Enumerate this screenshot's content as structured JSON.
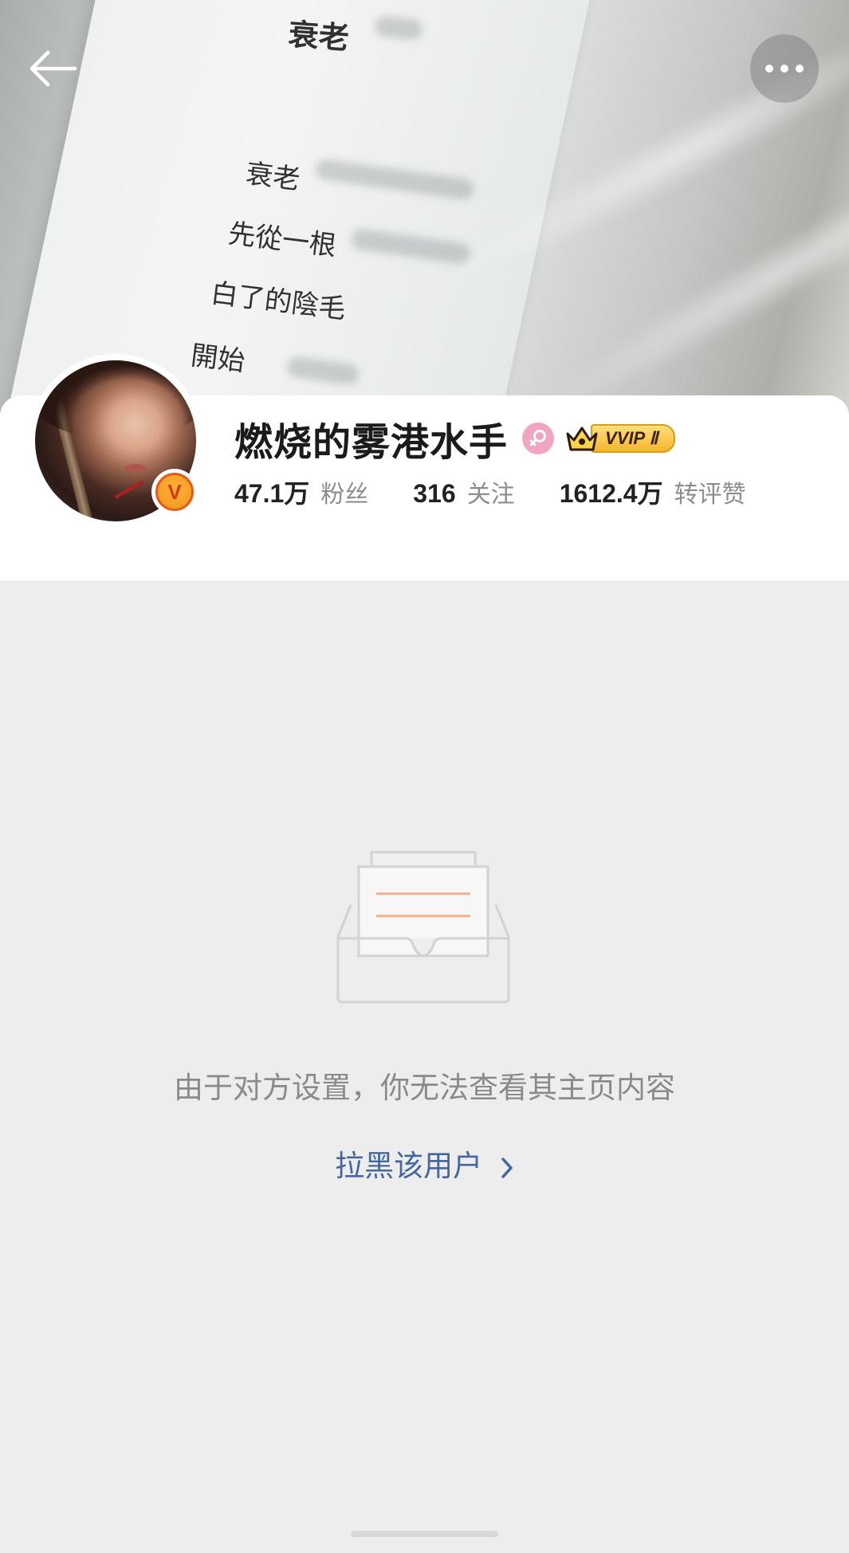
{
  "cover": {
    "title": "衰老",
    "lines": [
      "衰老",
      "先從一根",
      "白了的陰毛",
      "開始"
    ]
  },
  "profile": {
    "name": "燃烧的雾港水手",
    "verified_badge": "V",
    "vip_label": "VVIP Ⅱ",
    "stats": [
      {
        "value": "47.1万",
        "label": "粉丝"
      },
      {
        "value": "316",
        "label": "关注"
      },
      {
        "value": "1612.4万",
        "label": "转评赞"
      }
    ]
  },
  "empty_state": {
    "message": "由于对方设置，你无法查看其主页内容",
    "action_label": "拉黑该用户"
  },
  "colors": {
    "link": "#44689d",
    "muted_text": "#8a8a8a",
    "gender_female": "#f2a4c3",
    "vip_gold": "#f4b52e",
    "page_bg": "#ededed"
  },
  "icons": [
    "back-arrow-icon",
    "more-dots-icon",
    "verified-v-icon",
    "female-gender-icon",
    "crown-icon",
    "empty-inbox-icon",
    "chevron-right-icon"
  ]
}
